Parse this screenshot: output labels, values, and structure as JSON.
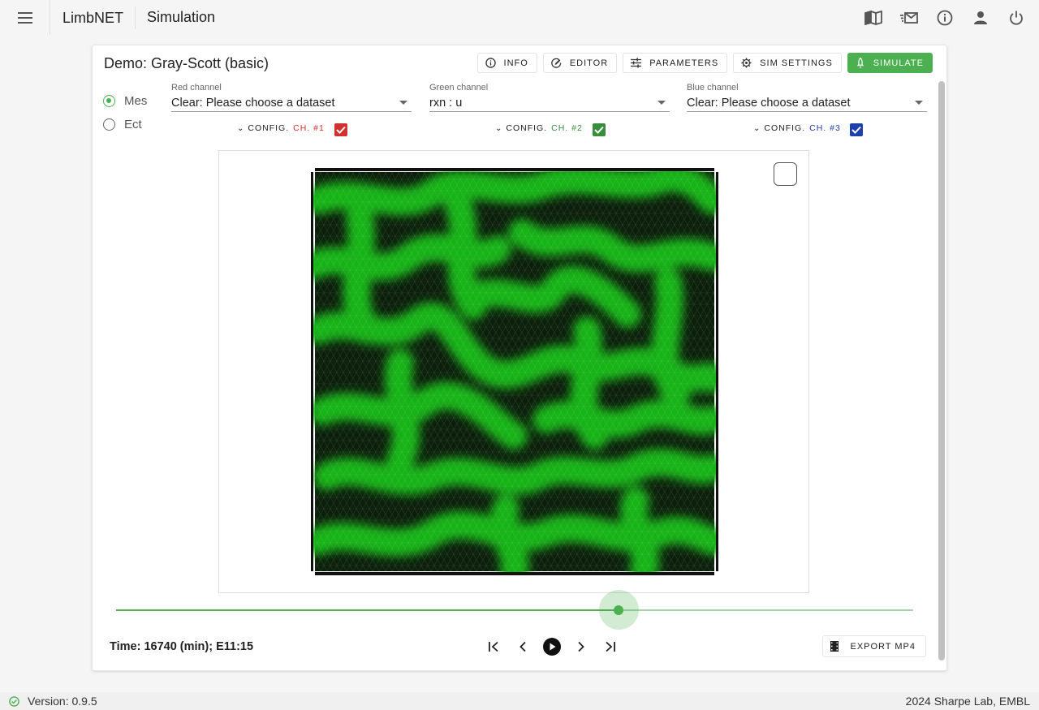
{
  "appbar": {
    "brand": "LimbNET",
    "page": "Simulation",
    "icons": [
      "menu-icon",
      "book-icon",
      "mail-icon",
      "info-icon",
      "account-icon",
      "power-icon"
    ]
  },
  "card": {
    "title": "Demo: Gray-Scott (basic)",
    "toolbar": {
      "info": "INFO",
      "editor": "EDITOR",
      "parameters": "PARAMETERS",
      "sim_settings": "SIM SETTINGS",
      "simulate": "SIMULATE"
    },
    "tissues": [
      {
        "label": "Mes",
        "selected": true
      },
      {
        "label": "Ect",
        "selected": false
      }
    ],
    "channels": [
      {
        "label": "Red channel",
        "value": "Clear: Please choose a dataset",
        "config": "CONFIG.",
        "ch": "CH. #1",
        "color": "#d32f2f",
        "checked": true
      },
      {
        "label": "Green channel",
        "value": "rxn : u",
        "config": "CONFIG.",
        "ch": "CH. #2",
        "color": "#388e3c",
        "checked": true
      },
      {
        "label": "Blue channel",
        "value": "Clear: Please choose a dataset",
        "config": "CONFIG.",
        "ch": "CH. #3",
        "color": "#1e40af",
        "checked": true
      }
    ],
    "slider_fraction": 0.63,
    "time_text": "Time: 16740 (min); E11:15",
    "export_label": "EXPORT MP4"
  },
  "footer": {
    "version": "Version: 0.9.5",
    "copyright": "2024 Sharpe Lab, EMBL"
  }
}
